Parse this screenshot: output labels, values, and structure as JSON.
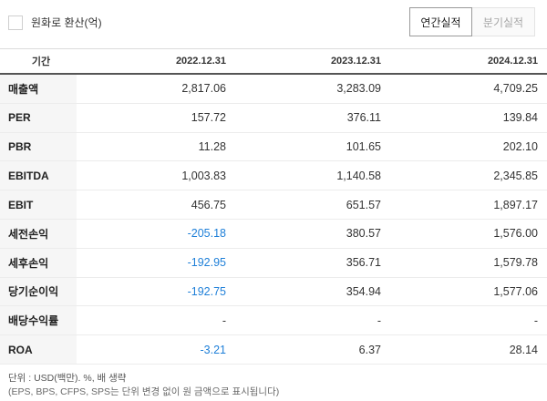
{
  "convert": {
    "label": "원화로 환산(억)"
  },
  "tabs": [
    {
      "label": "연간실적",
      "active": true
    },
    {
      "label": "분기실적",
      "active": false
    }
  ],
  "table": {
    "headers": [
      "기간",
      "2022.12.31",
      "2023.12.31",
      "2024.12.31"
    ],
    "rows": [
      {
        "label": "매출액",
        "values": [
          "2,817.06",
          "3,283.09",
          "4,709.25"
        ]
      },
      {
        "label": "PER",
        "values": [
          "157.72",
          "376.11",
          "139.84"
        ]
      },
      {
        "label": "PBR",
        "values": [
          "11.28",
          "101.65",
          "202.10"
        ]
      },
      {
        "label": "EBITDA",
        "values": [
          "1,003.83",
          "1,140.58",
          "2,345.85"
        ]
      },
      {
        "label": "EBIT",
        "values": [
          "456.75",
          "651.57",
          "1,897.17"
        ]
      },
      {
        "label": "세전손익",
        "values": [
          "-205.18",
          "380.57",
          "1,576.00"
        ]
      },
      {
        "label": "세후손익",
        "values": [
          "-192.95",
          "356.71",
          "1,579.78"
        ]
      },
      {
        "label": "당기순이익",
        "values": [
          "-192.75",
          "354.94",
          "1,577.06"
        ]
      },
      {
        "label": "배당수익률",
        "values": [
          "-",
          "-",
          "-"
        ]
      },
      {
        "label": "ROA",
        "values": [
          "-3.21",
          "6.37",
          "28.14"
        ]
      }
    ]
  },
  "footer": {
    "unit_note": "단위 : USD(백만). %, 배 생략",
    "eps_note": "(EPS, BPS, CFPS, SPS는 단위 변경 없이 원 금액으로 표시됩니다)"
  },
  "colors": {
    "negative": "#1e7fd8",
    "label_bg": "#f6f6f6"
  }
}
